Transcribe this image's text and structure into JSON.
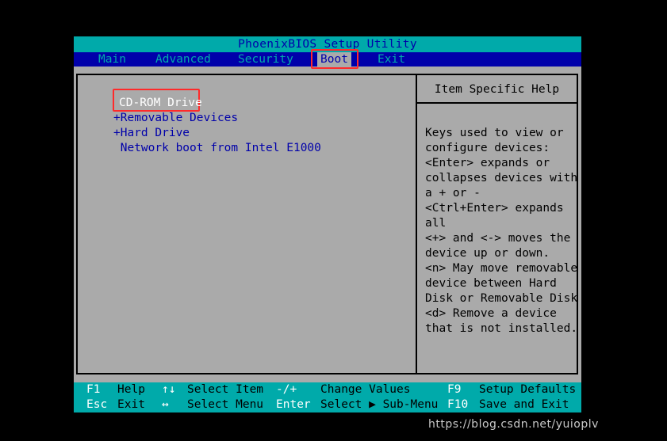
{
  "title": "PhoenixBIOS Setup Utility",
  "menu": {
    "main": "Main",
    "advanced": "Advanced",
    "security": "Security",
    "boot": "Boot",
    "exit": "Exit"
  },
  "boot_list": [
    "CD-ROM Drive",
    "+Removable Devices",
    "+Hard Drive",
    " Network boot from Intel E1000"
  ],
  "help": {
    "heading": "Item Specific Help",
    "lines": [
      "Keys used to view or",
      "configure devices:",
      "<Enter> expands or",
      "collapses devices with",
      "a + or -",
      "<Ctrl+Enter> expands",
      "all",
      "<+> and <-> moves the",
      "device up or down.",
      "<n> May move removable",
      "device between Hard",
      "Disk or Removable Disk",
      "<d> Remove a device",
      "that is not installed."
    ]
  },
  "footer": {
    "f1_key": "F1",
    "f1_desc": "Help",
    "updown_key": "↑↓",
    "updown_desc": "Select Item",
    "minusplus_key": "-/+",
    "minusplus_desc": "Change Values",
    "f9_key": "F9",
    "f9_desc": "Setup Defaults",
    "esc_key": "Esc",
    "esc_desc": "Exit",
    "leftright_key": "↔",
    "leftright_desc": "Select Menu",
    "enter_key": "Enter",
    "enter_desc": "Select ▶ Sub-Menu",
    "f10_key": "F10",
    "f10_desc": "Save and Exit"
  },
  "watermark": "https://blog.csdn.net/yuioplv",
  "colors": {
    "background": "#aaaaaa",
    "title_bar": "#00aaaa",
    "menu_bar": "#0000aa",
    "highlight_box": "#ff2a2a"
  }
}
